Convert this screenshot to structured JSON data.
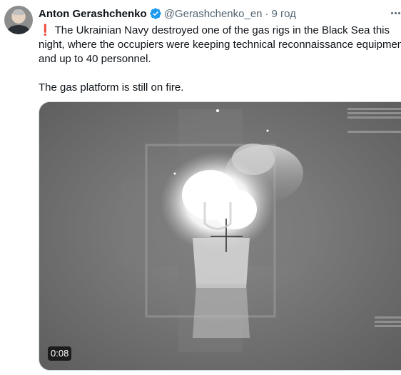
{
  "author": {
    "display_name": "Anton Gerashchenko",
    "handle": "@Gerashchenko_en",
    "separator": "·",
    "time": "9 год",
    "verified": true,
    "avatar_icon": "user-avatar"
  },
  "tweet": {
    "emoji": "❗",
    "line1": "The Ukrainian Navy destroyed one of the gas rigs in the Black Sea this",
    "line2": "night, where the occupiers were keeping technical reconnaissance equipment",
    "line3": "and up to 40 personnel.",
    "line4": "The gas platform is still on fire."
  },
  "media": {
    "type": "video",
    "duration": "0:08"
  },
  "colors": {
    "verified": "#1d9bf0",
    "alert": "#d81b1b",
    "secondary_text": "#536471"
  }
}
